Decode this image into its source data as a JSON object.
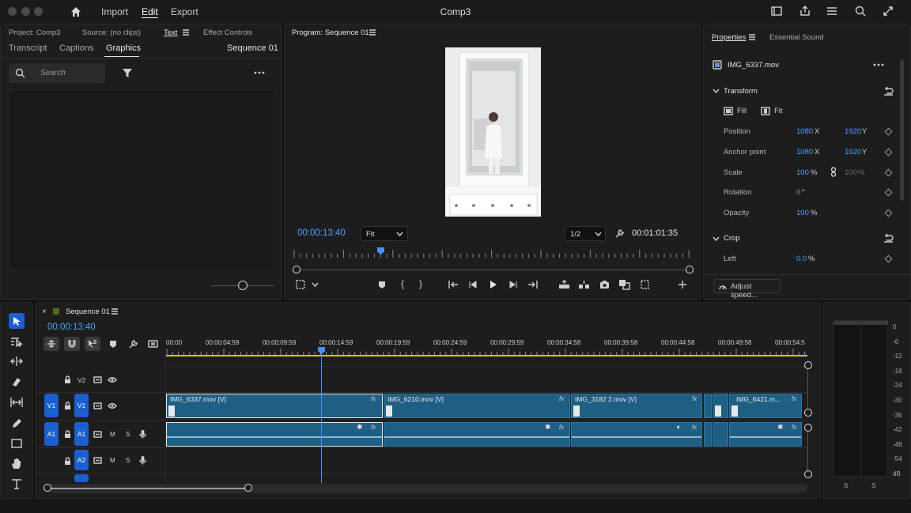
{
  "app": {
    "title": "Comp3",
    "menu": [
      "Import",
      "Edit",
      "Export"
    ],
    "active_menu": "Edit"
  },
  "source_panel": {
    "tabs_row1": [
      "Project: Comp3",
      "Source: (no clips)",
      "Text",
      "Effect Controls"
    ],
    "tabs_row2": [
      "Transcript",
      "Captions",
      "Graphics"
    ],
    "active_tab": "Graphics",
    "sequence_label": "Sequence 01",
    "search_placeholder": "Search"
  },
  "program_monitor": {
    "title": "Program: Sequence 01",
    "timecode": "00:00:13:40",
    "fit_value": "Fit",
    "resolution": "1/2",
    "duration": "00:01:01:35",
    "playhead_fraction": 0.22
  },
  "properties": {
    "tabs": [
      "Properties",
      "Essential Sound"
    ],
    "active_tab": "Properties",
    "clip_name": "IMG_6337.mov",
    "transform_label": "Transform",
    "fill_label": "Fill",
    "fit_label": "Fit",
    "position_label": "Position",
    "position_x": "1080",
    "position_y": "1920",
    "anchor_label": "Anchor point",
    "anchor_x": "1080",
    "anchor_y": "1920",
    "scale_label": "Scale",
    "scale_value": "100",
    "scale_value2": "100",
    "rotation_label": "Rotation",
    "rotation_value": "0",
    "opacity_label": "Opacity",
    "opacity_value": "100",
    "crop_label": "Crop",
    "left_label": "Left",
    "left_value": "0.0",
    "x_unit": "X",
    "y_unit": "Y",
    "percent": "%",
    "degree": "°",
    "adjust_speed": "Adjust speed..."
  },
  "timeline": {
    "sequence_tab": "Sequence 01",
    "timecode": "00:00:13:40",
    "ruler": [
      "00:00",
      "00:00:04:59",
      "00:00:09:59",
      "00:00:14:59",
      "00:00:19:59",
      "00:00:24:59",
      "00:00:29:59",
      "00:00:34:58",
      "00:00:39:58",
      "00:00:44:58",
      "00:00:49:58",
      "00:00:54:5"
    ],
    "tracks": {
      "v2": "V2",
      "v1": "V1",
      "a1": "A1",
      "a2": "A2",
      "m": "M",
      "s": "S"
    },
    "clips": [
      {
        "name": "IMG_6337.mov [V]"
      },
      {
        "name": "IMG_6210.mov [V]"
      },
      {
        "name": "IMG_3182 2.mov [V]"
      },
      {
        "name": "IMG_6421.m..."
      }
    ],
    "fx": "fx"
  },
  "meter": {
    "labels": [
      "0",
      "-6",
      "-12",
      "-18",
      "-24",
      "-30",
      "-36",
      "-42",
      "-48",
      "-54",
      "dB"
    ],
    "solo_labels": [
      "S",
      "S"
    ]
  },
  "colors": {
    "accent": "#4aa3ff",
    "track_blue": "#1a5fd0",
    "clip_fill": "#1f5f84",
    "playhead": "#4a8fff"
  }
}
